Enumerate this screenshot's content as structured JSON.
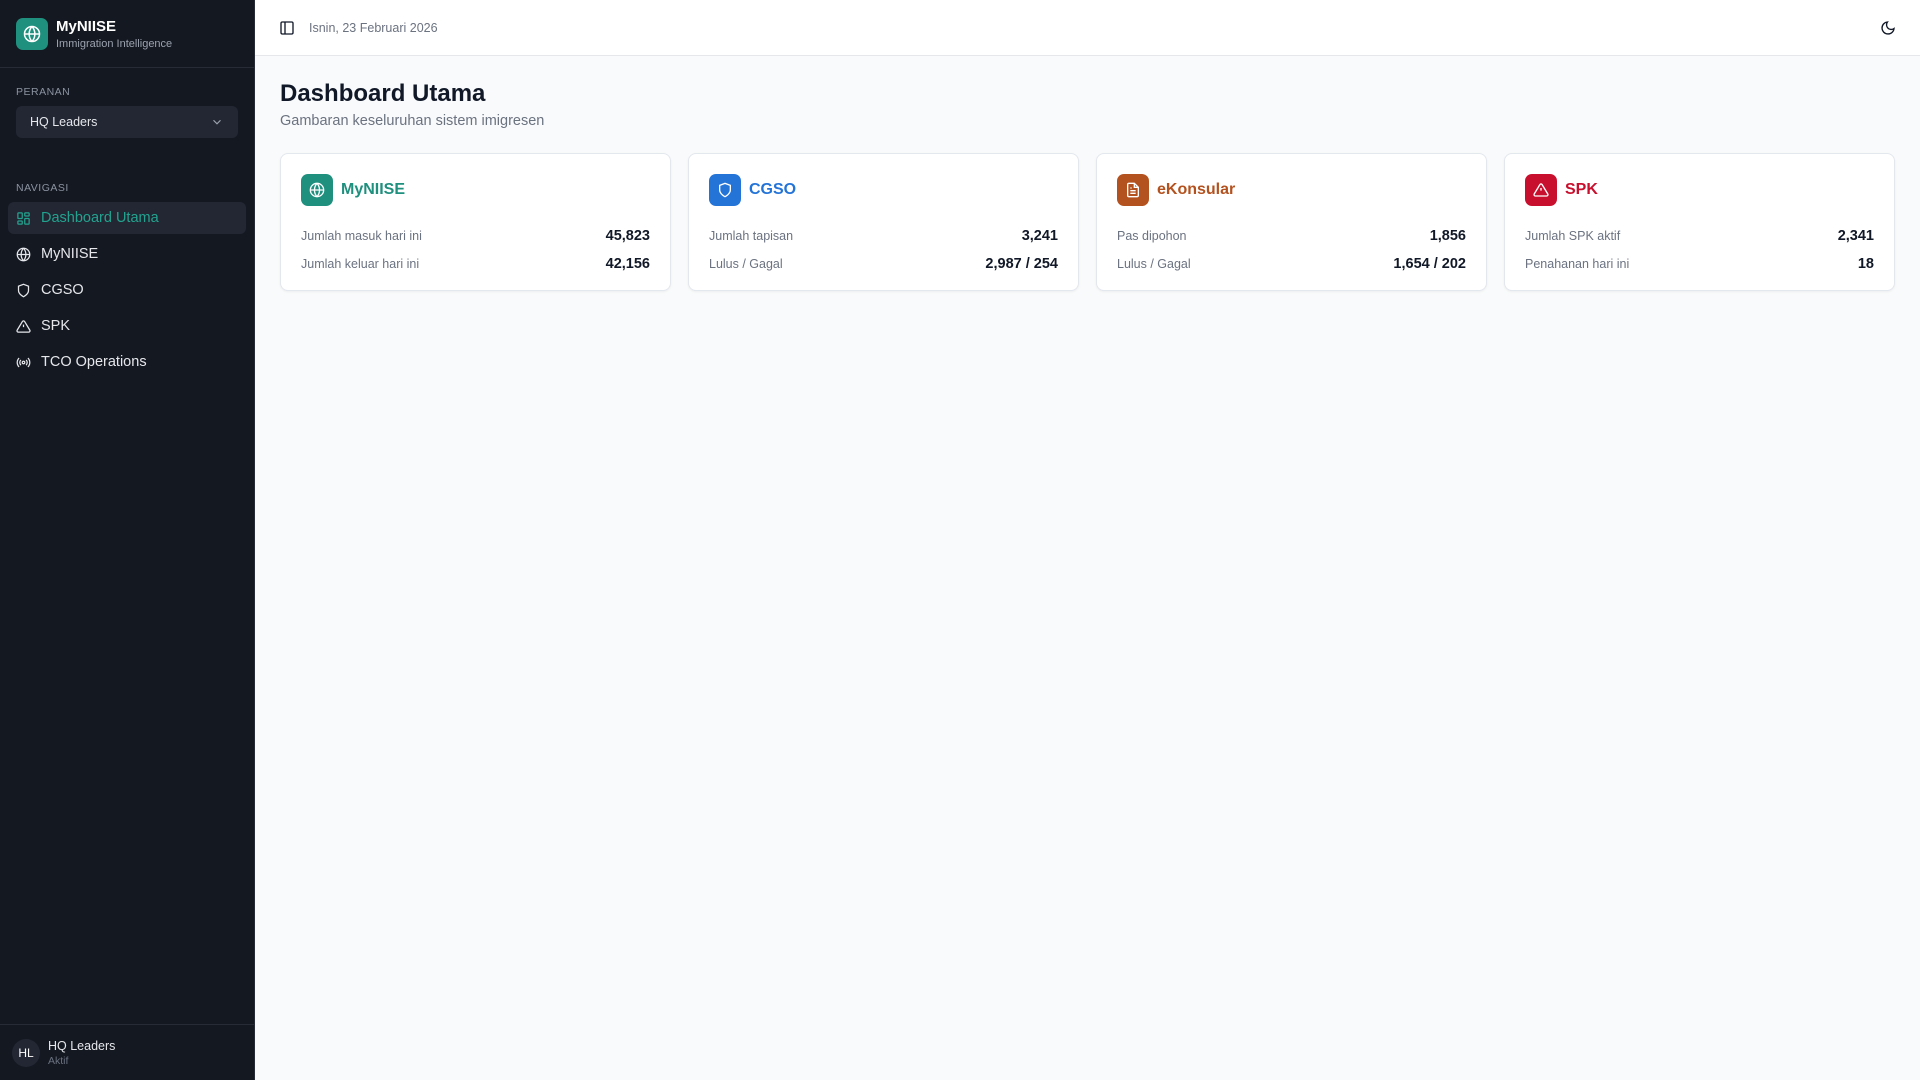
{
  "brand": {
    "name": "MyNIISE",
    "subtitle": "Immigration Intelligence"
  },
  "role": {
    "label": "PERANAN",
    "selected": "HQ Leaders"
  },
  "nav": {
    "label": "NAVIGASI",
    "items": [
      {
        "label": "Dashboard Utama",
        "icon": "dashboard-icon"
      },
      {
        "label": "MyNIISE",
        "icon": "globe-icon"
      },
      {
        "label": "CGSO",
        "icon": "shield-icon"
      },
      {
        "label": "SPK",
        "icon": "warning-icon"
      },
      {
        "label": "TCO Operations",
        "icon": "radio-icon"
      }
    ]
  },
  "user": {
    "initials": "HL",
    "name": "HQ Leaders",
    "status": "Aktif"
  },
  "header": {
    "date": "Isnin, 23 Februari 2026"
  },
  "page": {
    "title": "Dashboard Utama",
    "subtitle": "Gambaran keseluruhan sistem imigresen"
  },
  "cards": [
    {
      "title": "MyNIISE",
      "color": "#1f8f7e",
      "rows": [
        {
          "label": "Jumlah masuk hari ini",
          "value": "45,823"
        },
        {
          "label": "Jumlah keluar hari ini",
          "value": "42,156"
        }
      ]
    },
    {
      "title": "CGSO",
      "color": "#2474d8",
      "rows": [
        {
          "label": "Jumlah tapisan",
          "value": "3,241"
        },
        {
          "label": "Lulus / Gagal",
          "value": "2,987 / 254"
        }
      ]
    },
    {
      "title": "eKonsular",
      "color": "#b4521f",
      "rows": [
        {
          "label": "Pas dipohon",
          "value": "1,856"
        },
        {
          "label": "Lulus / Gagal",
          "value": "1,654 / 202"
        }
      ]
    },
    {
      "title": "SPK",
      "color": "#c8102e",
      "rows": [
        {
          "label": "Jumlah SPK aktif",
          "value": "2,341"
        },
        {
          "label": "Penahanan hari ini",
          "value": "18"
        }
      ]
    }
  ]
}
